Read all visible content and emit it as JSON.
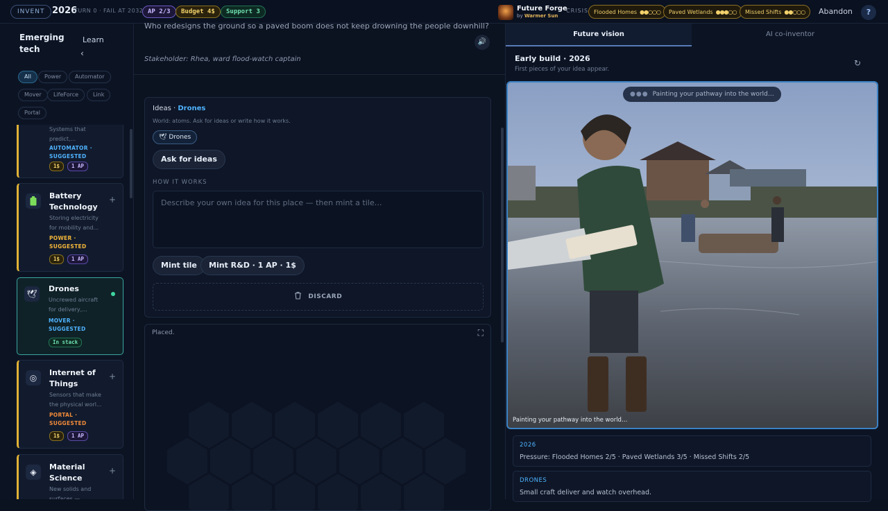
{
  "topbar": {
    "mode": "INVENT",
    "year": "2026",
    "turn_label": "TURN 0 · FAIL AT 2032",
    "ap": "AP 2/3",
    "budget": "Budget 4$",
    "support": "Support 3",
    "app_title": "Future Forge",
    "app_by": "by",
    "app_author": "Warmer Sun",
    "crisis_label": "CRISIS",
    "crises": [
      {
        "label": "Flooded Homes",
        "dots": "●●○○○"
      },
      {
        "label": "Paved Wetlands",
        "dots": "●●●○○"
      },
      {
        "label": "Missed Shifts",
        "dots": "●●○○○"
      }
    ],
    "abandon": "Abandon",
    "help": "?"
  },
  "sidebar": {
    "title": "Emerging tech",
    "learn": "Learn",
    "back": "‹",
    "filters": [
      "All",
      "Power",
      "Automator",
      "Mover",
      "LifeForce",
      "Link",
      "Portal"
    ],
    "active_filter": "All",
    "cards": [
      {
        "title": "",
        "desc": "Systems that predict,...",
        "category": "AUTOMATOR ·",
        "status": "SUGGESTED",
        "cost": "1$",
        "ap": "1 AP",
        "color": "#4fb3ff"
      },
      {
        "title": "Battery Technology",
        "desc": "Storing electricity for mobility and...",
        "category": "POWER ·",
        "status": "SUGGESTED",
        "cost": "1$",
        "ap": "1 AP",
        "color": "#f3b63a"
      },
      {
        "title": "Drones",
        "desc": "Uncrewed aircraft for delivery,...",
        "category": "MOVER ·",
        "status": "SUGGESTED",
        "stack": "In stack",
        "color": "#4fb3ff"
      },
      {
        "title": "Internet of Things",
        "desc": "Sensors that make the physical worl...",
        "category": "PORTAL ·",
        "status": "SUGGESTED",
        "cost": "1$",
        "ap": "1 AP",
        "color": "#f08a3a"
      },
      {
        "title": "Material Science",
        "desc": "New solids and surfaces —",
        "category": "",
        "status": "",
        "color": "#4fb3ff"
      }
    ]
  },
  "middle": {
    "question": "Who redesigns the ground so a paved boom does not keep drowning the people downhill?",
    "stakeholder": "Stakeholder: Rhea, ward flood-watch captain",
    "ideas_prefix": "Ideas ·",
    "ideas_tech": "Drones",
    "ideas_sub": "World: atoms. Ask for ideas or write how it works.",
    "chip": "Drones",
    "ask_button": "Ask for ideas",
    "how_label": "HOW IT WORKS",
    "textarea_placeholder": "Describe your own idea for this place — then mint a tile…",
    "mint_button": "Mint tile",
    "mint_rd_button": "Mint R&D · 1 AP · 1$",
    "discard_button": "DISCARD",
    "placed_label": "Placed."
  },
  "right": {
    "tabs": [
      "Future vision",
      "AI co-inventor"
    ],
    "build_title": "Early build · 2026",
    "build_sub": "First pieces of your idea appear.",
    "image_status": "Painting your pathway into the world…",
    "image_caption": "Painting your pathway into the world…",
    "info": [
      {
        "key": "2026",
        "value": "Pressure: Flooded Homes 2/5 · Paved Wetlands 3/5 · Missed Shifts 2/5"
      },
      {
        "key": "DRONES",
        "value": "Small craft deliver and watch overhead."
      }
    ]
  }
}
